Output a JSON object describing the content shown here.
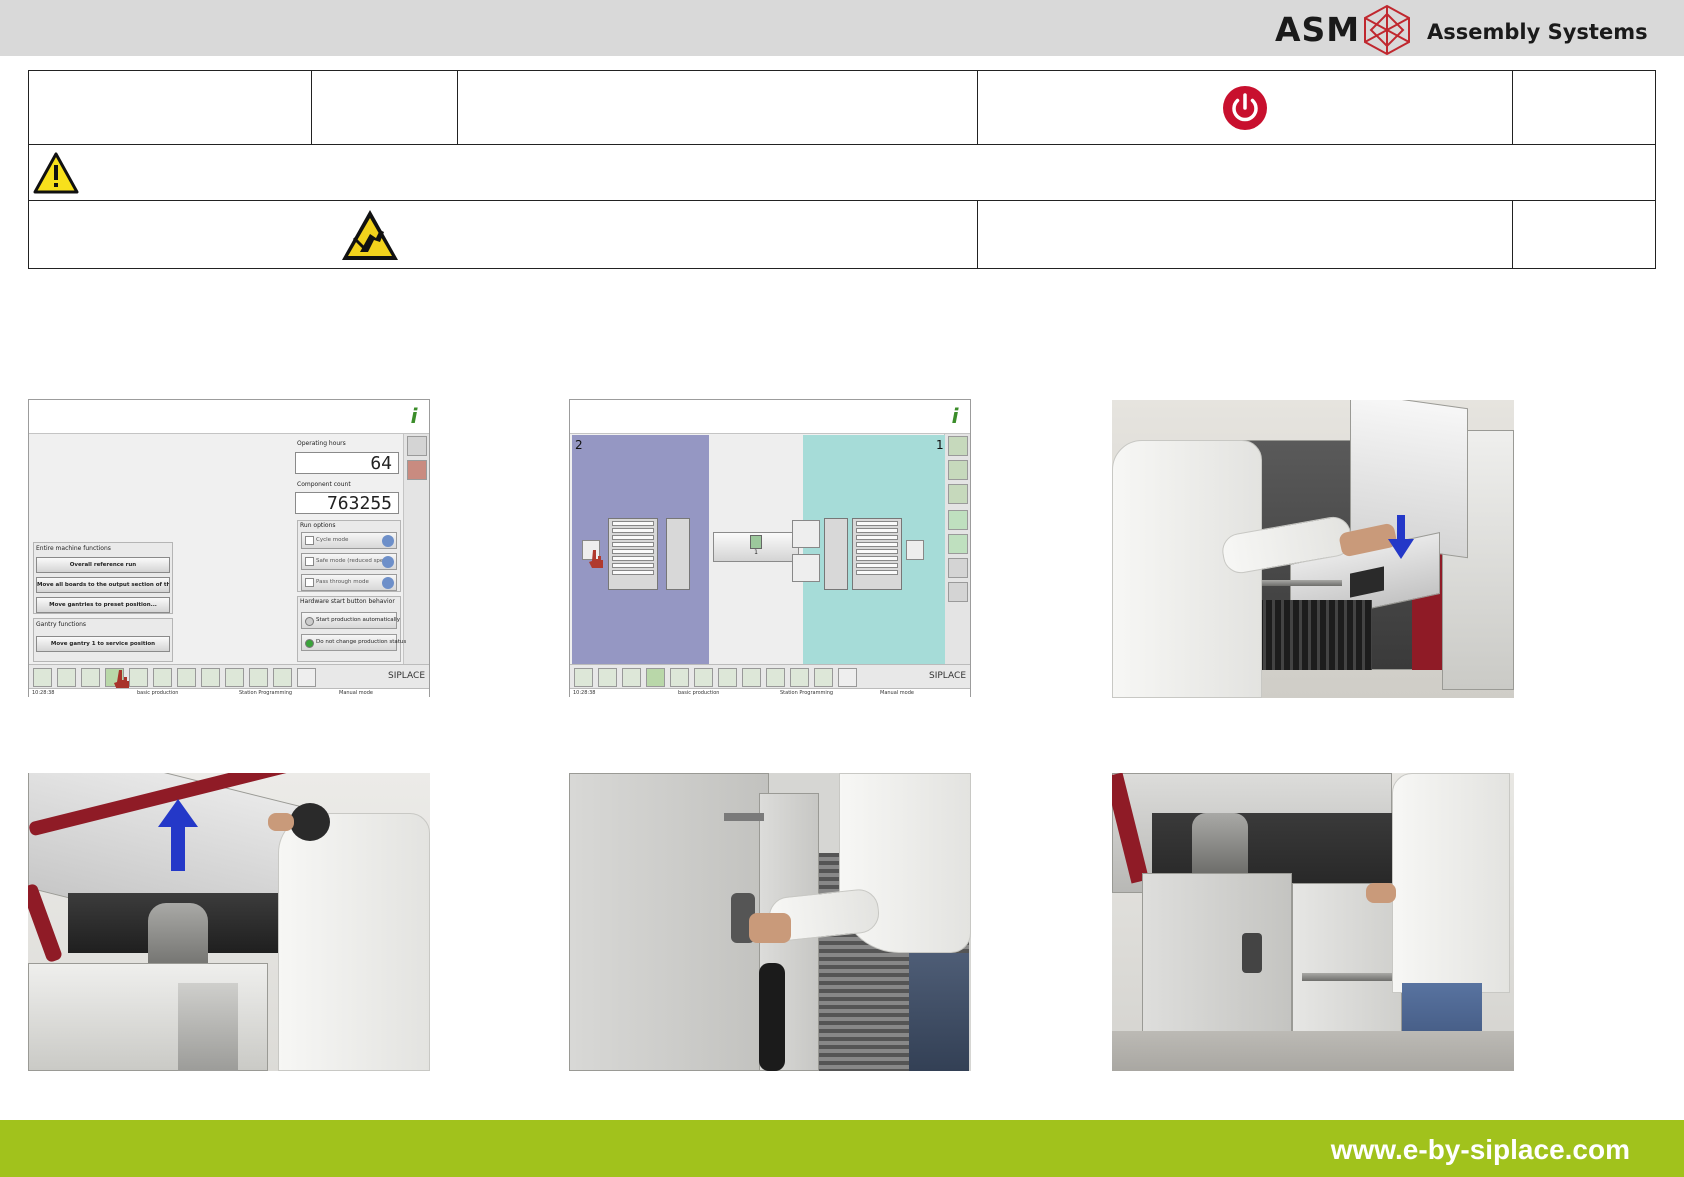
{
  "header": {
    "brand": "ASM",
    "subtitle": "Assembly Systems",
    "logo_icon": "asm-crystal-logo",
    "background": "#d9d9d9",
    "logo_color": "#c0282f"
  },
  "info_table": {
    "power_icon": "power-icon",
    "power_color": "#c8102e",
    "warning_icon": "warning-triangle-icon",
    "esd_icon": "esd-warning-icon"
  },
  "screenshot1": {
    "operating_hours_label": "Operating hours",
    "operating_hours": "64",
    "component_count_label": "Component count",
    "component_count": "763255",
    "run_options_label": "Run options",
    "options": [
      "Cycle mode",
      "Safe mode (reduced speed)",
      "Pass through mode"
    ],
    "hardware_label": "Hardware start button behavior",
    "hardware_options": [
      "Start production automatically",
      "Do not change production status"
    ],
    "entire_label": "Entire machine functions",
    "entire_buttons": [
      "Overall reference run",
      "Move all boards to the output section of the machine",
      "Move gantries to preset position..."
    ],
    "gantry_label": "Gantry functions",
    "gantry_buttons": [
      "Move gantry 1 to service position"
    ],
    "logo": "SIPLACE",
    "status": [
      "10:28:38",
      "basic production",
      "Station Programming",
      "Manual mode"
    ]
  },
  "screenshot2": {
    "left_number": "2",
    "right_number": "1",
    "center_label": "1",
    "logo": "SIPLACE",
    "status": [
      "10:28:38",
      "basic production",
      "Station Programming",
      "Manual mode"
    ]
  },
  "footer": {
    "url": "www.e-by-siplace.com",
    "background": "#a1c21c"
  }
}
